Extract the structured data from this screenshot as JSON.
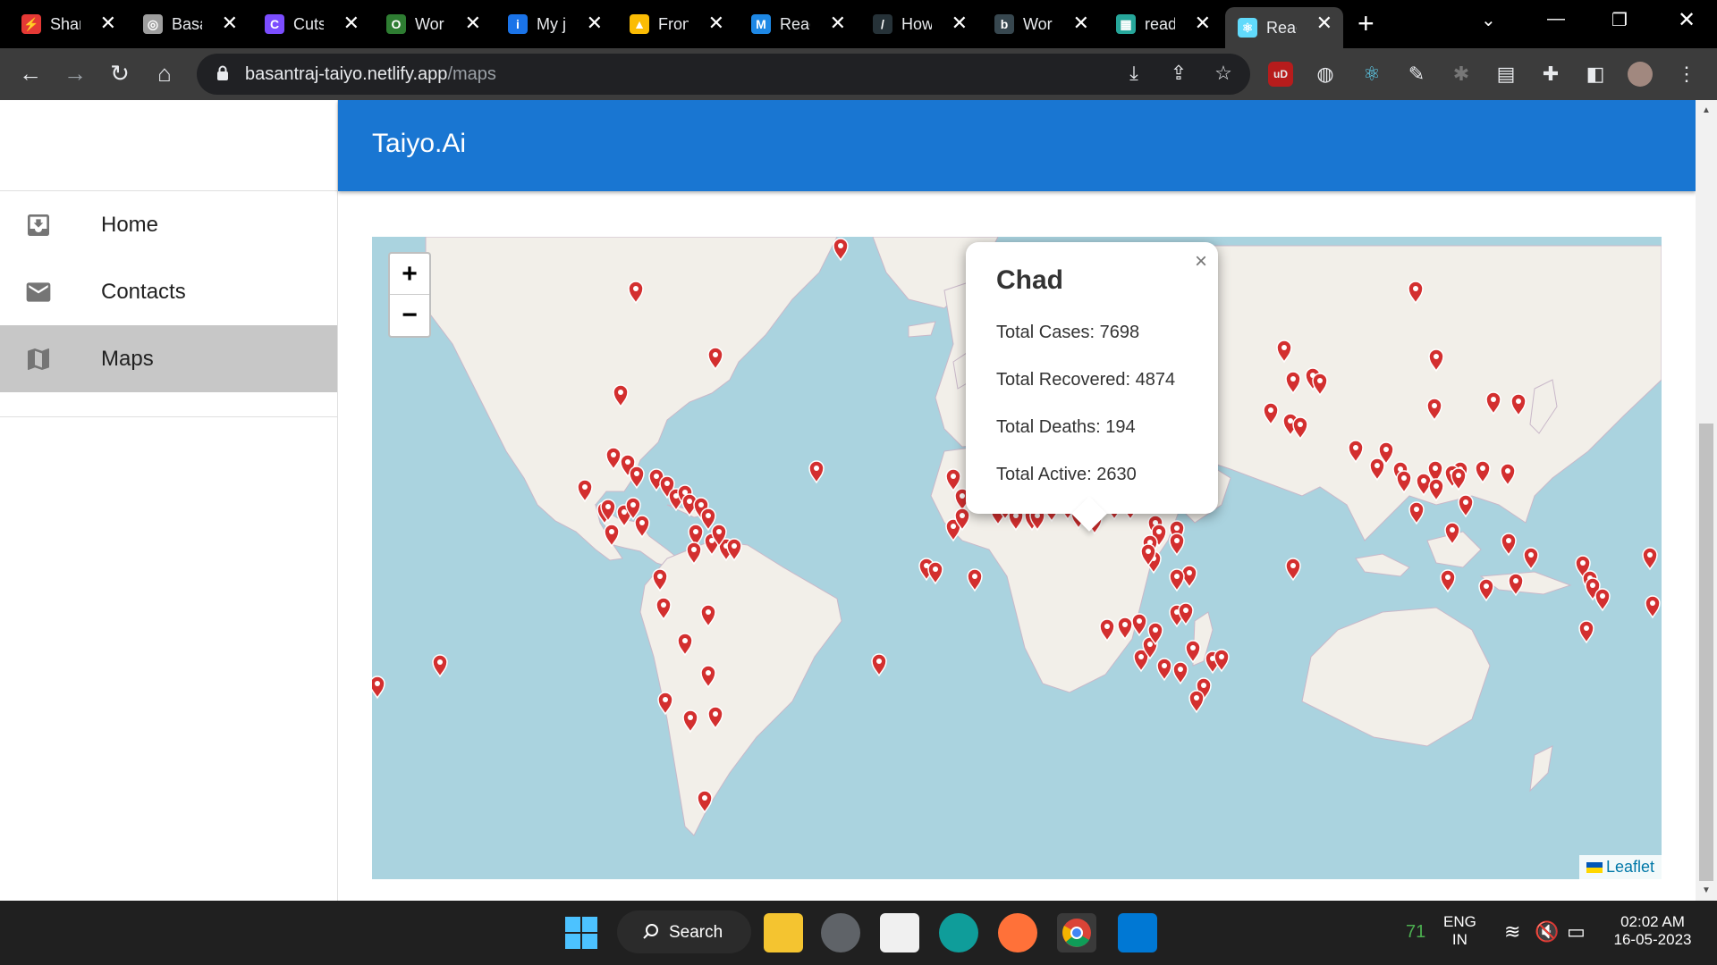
{
  "browser": {
    "tabs": [
      {
        "label": "Shar",
        "color": "#e53935",
        "glyph": "⚡"
      },
      {
        "label": "Basa",
        "color": "#9e9e9e",
        "glyph": "◎"
      },
      {
        "label": "Cuts",
        "color": "#7b4dff",
        "glyph": "C"
      },
      {
        "label": "Wor",
        "color": "#2e7d32",
        "glyph": "O"
      },
      {
        "label": "My j",
        "color": "#1a73e8",
        "glyph": "i"
      },
      {
        "label": "Fron",
        "color": "#fbbc04",
        "glyph": "▲"
      },
      {
        "label": "Reac",
        "color": "#1e88e5",
        "glyph": "M"
      },
      {
        "label": "How",
        "color": "#263238",
        "glyph": "/"
      },
      {
        "label": "Wor",
        "color": "#37474f",
        "glyph": "b"
      },
      {
        "label": "read",
        "color": "#26a69a",
        "glyph": "▦"
      },
      {
        "label": "Reac",
        "color": "#61dafb",
        "glyph": "⚛",
        "active": true
      }
    ],
    "url_host": "basantraj-taiyo.netlify.app",
    "url_path": "/maps"
  },
  "app": {
    "title": "Taiyo.Ai",
    "nav": [
      {
        "label": "Home",
        "icon": "inbox-download-icon",
        "selected": false
      },
      {
        "label": "Contacts",
        "icon": "mail-icon",
        "selected": false
      },
      {
        "label": "Maps",
        "icon": "map-icon",
        "selected": true
      }
    ]
  },
  "map": {
    "zoom_in": "+",
    "zoom_out": "−",
    "attribution": "Leaflet",
    "popup": {
      "country": "Chad",
      "cases": "Total Cases: 7698",
      "recovered": "Total Recovered: 4874",
      "deaths": "Total Deaths: 194",
      "active": "Total Active: 2630",
      "close": "×"
    }
  },
  "taskbar": {
    "search": "Search",
    "temp": "71",
    "lang1": "ENG",
    "lang2": "IN",
    "time": "02:02 AM",
    "date": "16-05-2023"
  }
}
